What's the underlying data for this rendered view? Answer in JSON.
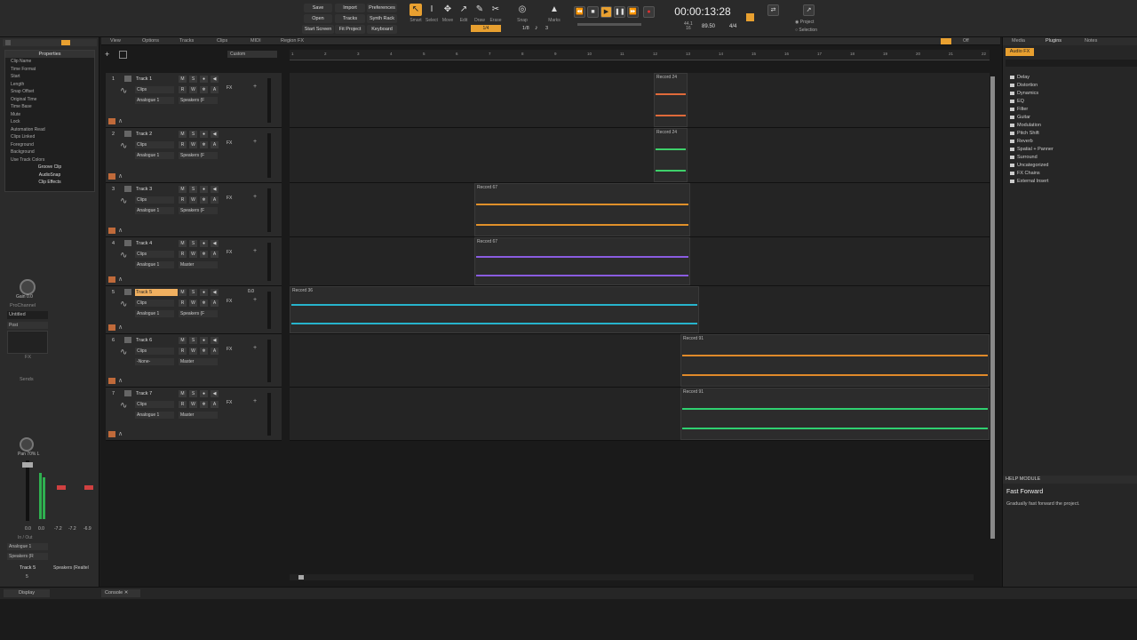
{
  "control_bar": {
    "quick_buttons": [
      "Save",
      "Import",
      "Preferences",
      "Open",
      "Tracks",
      "Synth Rack",
      "Start Screen",
      "Fit Project",
      "Keyboard"
    ],
    "tools": [
      {
        "label": "Smart",
        "icon": "smart-tool-icon"
      },
      {
        "label": "Select",
        "icon": "select-tool-icon"
      },
      {
        "label": "Move",
        "icon": "move-tool-icon"
      },
      {
        "label": "Edit",
        "icon": "edit-tool-icon"
      },
      {
        "label": "Draw",
        "icon": "draw-tool-icon"
      },
      {
        "label": "Erase",
        "icon": "erase-tool-icon"
      }
    ],
    "snap_label": "Snap",
    "snap_value": "1/4",
    "marks_label": "Marks",
    "grid_value": "1/8",
    "grid_value2": "3",
    "time": "00:00:13:28",
    "sample_rate": "44.1",
    "bit_depth": "16",
    "tempo": "89.50",
    "meter": "4/4",
    "export_project": "Project",
    "export_selection": "Selection"
  },
  "inspector": {
    "title": "Properties",
    "properties": [
      "Clip Name",
      "Time Format",
      "Start",
      "Length",
      "Snap Offset",
      "Original Time",
      "Time Base",
      "Mute",
      "Lock",
      "Automation Read",
      "Clips Linked",
      "Foreground",
      "Background",
      "Use Track Colors"
    ],
    "sections": [
      "Groove Clip",
      "AudioSnap",
      "Clip Effects"
    ],
    "gain_label": "Gain",
    "gain_value": "0.0",
    "prochannel": "ProChannel",
    "preset": "Untitled",
    "post": "Post",
    "fx": "FX",
    "sends": "Sends",
    "pan_label": "Pan",
    "pan_value": "70% L",
    "level_left": "0.0",
    "level_right": "0.0",
    "level_2a": "-7.2",
    "level_2b": "-7.2",
    "level_2c": "-6.9",
    "in_out": "In / Out",
    "input": "Analogue 1",
    "output": "Speakers (R",
    "strip_name": "Track 5",
    "strip_out": "Speakers (Realtel",
    "strip_num": "5",
    "display": "Display"
  },
  "track_view": {
    "menus": [
      "View",
      "Options",
      "Tracks",
      "Clips",
      "MIDI",
      "Region FX"
    ],
    "custom": "Custom",
    "off_label": "Off",
    "ruler": [
      "1",
      "2",
      "3",
      "4",
      "5",
      "6",
      "7",
      "8",
      "9",
      "10",
      "11",
      "12",
      "13",
      "14",
      "15",
      "16",
      "17",
      "18",
      "19",
      "20",
      "21",
      "22"
    ],
    "tracks": [
      {
        "num": "1",
        "name": "Track 1",
        "mode": "Clips",
        "input": "Analogue 1",
        "output": "Speakers (F",
        "fx": "FX"
      },
      {
        "num": "2",
        "name": "Track 2",
        "mode": "Clips",
        "input": "Analogue 1",
        "output": "Speakers (F",
        "fx": "FX"
      },
      {
        "num": "3",
        "name": "Track 3",
        "mode": "Clips",
        "input": "Analogue 1",
        "output": "Speakers (F",
        "fx": "FX"
      },
      {
        "num": "4",
        "name": "Track 4",
        "mode": "Clips",
        "input": "Analogue 1",
        "output": "Master",
        "fx": "FX"
      },
      {
        "num": "5",
        "name": "Track 5",
        "mode": "Clips",
        "input": "Analogue 1",
        "output": "Speakers (F",
        "fx": "FX",
        "vol": "0.0"
      },
      {
        "num": "6",
        "name": "Track 6",
        "mode": "Clips",
        "input": "-None-",
        "output": "Master",
        "fx": "FX"
      },
      {
        "num": "7",
        "name": "Track 7",
        "mode": "Clips",
        "input": "Analogue 1",
        "output": "Master",
        "fx": "FX"
      }
    ],
    "clips": [
      "Record 24",
      "Record 24",
      "Record 67",
      "Record 67",
      "Record 36",
      "Record 91",
      "Record 91"
    ],
    "colors": {
      "track1": "#e06a3a",
      "track2": "#3ed06a",
      "track3": "#e0902a",
      "track4": "#8a5ce0",
      "track5": "#27b4cc",
      "track6": "#e08a2a",
      "track7": "#2fd070"
    }
  },
  "browser": {
    "tabs": [
      "Media",
      "Plugins",
      "Notes"
    ],
    "category": "Audio FX",
    "items": [
      "Delay",
      "Distortion",
      "Dynamics",
      "EQ",
      "Filter",
      "Guitar",
      "Modulation",
      "Pitch Shift",
      "Reverb",
      "Spatial + Panner",
      "Surround",
      "Uncategorized",
      "FX Chains",
      "External Insert"
    ],
    "help_title": "HELP MODULE",
    "help_heading": "Fast Forward",
    "help_text": "Gradually fast forward the project."
  },
  "status": {
    "console": "Console"
  }
}
